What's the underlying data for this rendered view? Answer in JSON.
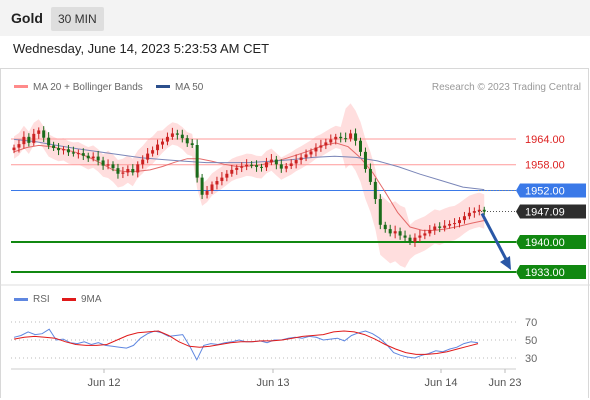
{
  "header": {
    "title": "Gold",
    "timeframe": "30 MIN"
  },
  "datetime": "Wednesday, June 14, 2023 5:23:53 AM CET",
  "legend": {
    "ma20_label": "MA 20 + Bollinger Bands",
    "ma50_label": "MA 50",
    "copyright": "Research © 2023 Trading Central",
    "rsi_label": "RSI",
    "rsi_ma_label": "9MA"
  },
  "colors": {
    "resistance": "#ff9a9a",
    "current_support": "#3a79e8",
    "support": "#118811",
    "candle_up": "#cc2222",
    "candle_down": "#1a6b1a",
    "bollinger": "#ffd6d6",
    "ma20": "#e46a6a",
    "ma50": "#7a86b8",
    "rsi": "#5f87e0",
    "rsi_ma": "#e01a1a",
    "arrow": "#2a57a6",
    "last_price_tag": "#2d2d2d"
  },
  "chart_data": {
    "type": "candlestick",
    "instrument": "Gold",
    "interval": "30 MIN",
    "price_axis": {
      "min": 1930,
      "max": 1975
    },
    "x_ticks": [
      "Jun 12",
      "Jun 13",
      "Jun 14",
      "Jun 23"
    ],
    "levels": [
      {
        "label": "1964.00",
        "value": 1964.0,
        "kind": "resistance"
      },
      {
        "label": "1958.00",
        "value": 1958.0,
        "kind": "resistance"
      },
      {
        "label": "1952.00",
        "value": 1952.0,
        "kind": "pivot"
      },
      {
        "label": "1940.00",
        "value": 1940.0,
        "kind": "support"
      },
      {
        "label": "1933.00",
        "value": 1933.0,
        "kind": "support"
      }
    ],
    "last_price": {
      "label": "1947.09",
      "value": 1947.09
    },
    "series": [
      {
        "name": "Price (close)",
        "values": [
          1962.0,
          1962.8,
          1964.5,
          1963.1,
          1965.2,
          1966.0,
          1964.3,
          1962.5,
          1961.9,
          1961.4,
          1961.6,
          1960.9,
          1960.6,
          1960.7,
          1960.1,
          1959.5,
          1959.9,
          1959.0,
          1957.8,
          1958.1,
          1957.2,
          1955.9,
          1956.2,
          1957.0,
          1956.2,
          1958.1,
          1959.2,
          1960.6,
          1961.4,
          1962.7,
          1963.4,
          1964.5,
          1965.3,
          1965.0,
          1964.2,
          1963.0,
          1962.6,
          1955.0,
          1951.0,
          1951.9,
          1953.4,
          1954.2,
          1955.0,
          1955.9,
          1956.8,
          1957.3,
          1957.6,
          1958.0,
          1957.9,
          1957.5,
          1957.4,
          1958.6,
          1959.2,
          1958.1,
          1957.1,
          1957.7,
          1958.3,
          1959.1,
          1959.7,
          1960.4,
          1961.1,
          1962.0,
          1962.5,
          1963.2,
          1963.9,
          1964.5,
          1964.2,
          1964.1,
          1965.3,
          1963.6,
          1961.0,
          1957.0,
          1954.0,
          1950.0,
          1944.0,
          1943.0,
          1942.0,
          1942.5,
          1941.5,
          1941.0,
          1940.0,
          1941.0,
          1941.5,
          1942.0,
          1942.8,
          1943.6,
          1943.3,
          1943.8,
          1944.2,
          1944.4,
          1945.1,
          1946.0,
          1946.8,
          1947.2,
          1947.5,
          1947.09
        ]
      },
      {
        "name": "MA 20",
        "values": [
          1961.0,
          1962.0,
          1962.5,
          1962.2,
          1961.6,
          1960.9,
          1959.8,
          1958.4,
          1956.8,
          1956.4,
          1956.5,
          1956.8,
          1957.6,
          1958.6,
          1959.4,
          1959.4,
          1958.8,
          1958.1,
          1957.6,
          1957.7,
          1958.0,
          1958.7,
          1959.5,
          1960.4,
          1961.4,
          1962.5,
          1963.1,
          1962.2,
          1959.6,
          1956.1,
          1951.6,
          1946.9,
          1943.5,
          1942.7,
          1942.7,
          1943.1,
          1943.7,
          1944.4,
          1945.0
        ]
      },
      {
        "name": "MA 50",
        "values": [
          1963.9,
          1963.4,
          1962.5,
          1961.7,
          1961.0,
          1960.3,
          1959.6,
          1959.2,
          1958.8,
          1958.5,
          1958.5,
          1958.5,
          1958.8,
          1959.2,
          1959.7,
          1960.0,
          1959.7,
          1958.9,
          1957.5,
          1955.8,
          1954.3,
          1952.8,
          1952.2
        ]
      },
      {
        "name": "RSI",
        "values": [
          53,
          55,
          59,
          56,
          57,
          62,
          50,
          51,
          47,
          46,
          48,
          45,
          47,
          44,
          43,
          42,
          41,
          44,
          52,
          57,
          60,
          58,
          54,
          55,
          56,
          43,
          28,
          44,
          46,
          45,
          47,
          48,
          50,
          48,
          48,
          49,
          47,
          50,
          50,
          52,
          53,
          52,
          54,
          53,
          50,
          51,
          52,
          49,
          55,
          58,
          60,
          57,
          52,
          45,
          36,
          33,
          31,
          30,
          33,
          35,
          38,
          37,
          40,
          42,
          46,
          48,
          47
        ]
      },
      {
        "name": "9MA",
        "values": [
          51,
          53,
          54,
          53,
          52,
          48,
          45,
          44,
          44,
          45,
          50,
          55,
          58,
          59,
          60,
          55,
          48,
          43,
          42,
          43,
          45,
          47,
          48,
          48,
          49,
          49,
          50,
          52,
          54,
          55,
          56,
          59,
          60,
          59,
          56,
          51,
          45,
          40,
          36,
          34,
          34,
          35,
          37,
          40,
          43,
          46
        ]
      }
    ],
    "rsi_axis": {
      "ticks": [
        70,
        50,
        30
      ]
    },
    "forecast_arrow": {
      "from": 1947.09,
      "to": 1933.0
    }
  }
}
